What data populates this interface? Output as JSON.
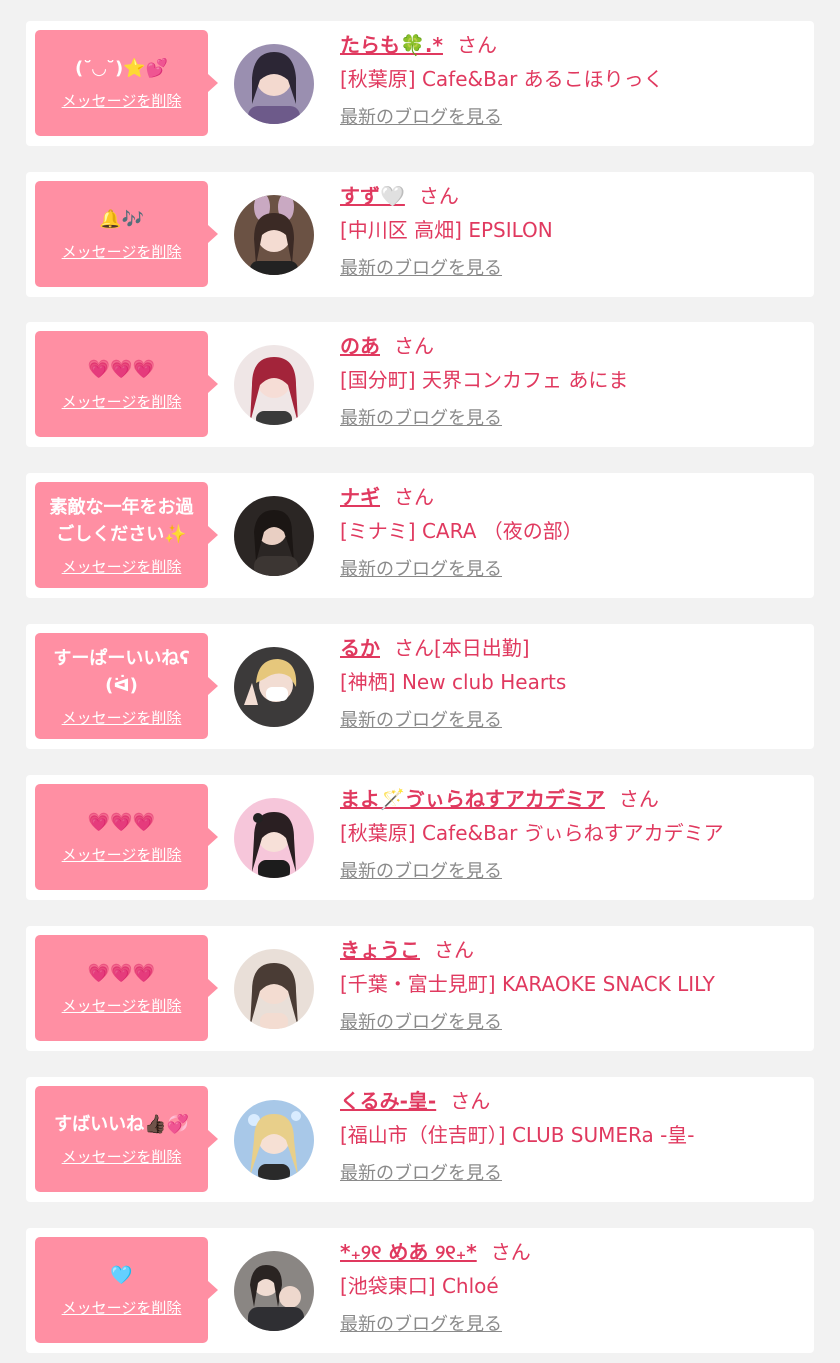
{
  "common": {
    "delete_label": "メッセージを削除",
    "blog_label": "最新のブログを見る",
    "san_label": "さん"
  },
  "colors": {
    "background": "#f2f2f2",
    "bubble": "#ff8fa3",
    "accent_text": "#e0395f",
    "link_gray": "#8a8a8a"
  },
  "items": [
    {
      "message": "(˘◡˘)⭐💕",
      "name": "たらも🍀.*",
      "suffix": "",
      "shop": "[秋葉原] Cafe&Bar あるこほりっく"
    },
    {
      "message": "🔔🎶",
      "name": "すず🤍",
      "suffix": "",
      "shop": "[中川区 高畑] EPSILON"
    },
    {
      "message": "💗💗💗",
      "name": "のあ",
      "suffix": "",
      "shop": "[国分町] 天界コンカフェ あにま"
    },
    {
      "message": "素敵な一年をお過ごしください✨",
      "name": "ナギ",
      "suffix": "",
      "shop": "[ミナミ] CARA （夜の部）"
    },
    {
      "message": "すーぱーいいねʕ(ᐛ)",
      "name": "るか",
      "suffix": "[本日出勤]",
      "shop": "[神栖] New club Hearts"
    },
    {
      "message": "💗💗💗",
      "name": "まよ🪄ゔぃらねすアカデミア",
      "suffix": "",
      "shop": "[秋葉原] Cafe&Bar ゔぃらねすアカデミア"
    },
    {
      "message": "💗💗💗",
      "name": "きょうこ",
      "suffix": "",
      "shop": "[千葉・富士見町] KARAOKE SNACK LILY"
    },
    {
      "message": "すばいいね👍🏿💞",
      "name": "くるみ-皇-",
      "suffix": "",
      "shop": "[福山市（住吉町）] CLUB SUMERa -皇-"
    },
    {
      "message": "🩵",
      "name": "*₊୨୧ めあ ୨୧₊*",
      "suffix": "",
      "shop": "[池袋東口] Chloé"
    }
  ]
}
